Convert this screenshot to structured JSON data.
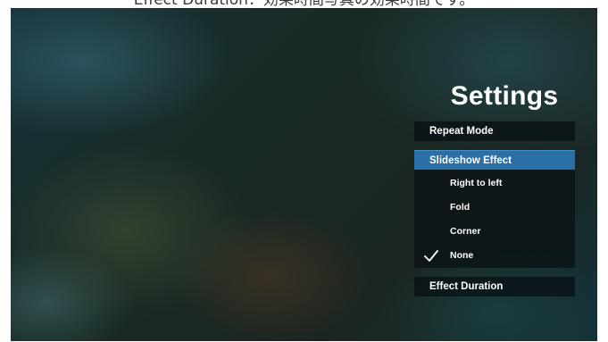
{
  "caption": "Effect Duration：効果時間写真の効果時間です。",
  "title": "Settings",
  "menu": {
    "repeat_mode": "Repeat Mode",
    "slideshow_effect": "Slideshow Effect",
    "effect_duration": "Effect Duration"
  },
  "slideshow_options": [
    {
      "label": "Right to left",
      "selected": false
    },
    {
      "label": "Fold",
      "selected": false
    },
    {
      "label": "Corner",
      "selected": false
    },
    {
      "label": "None",
      "selected": true
    }
  ],
  "colors": {
    "highlight": "#2a6fa6",
    "panel": "#0a1216",
    "text": "#ffffff"
  },
  "icons": {
    "selected_option": "checkmark-icon"
  }
}
